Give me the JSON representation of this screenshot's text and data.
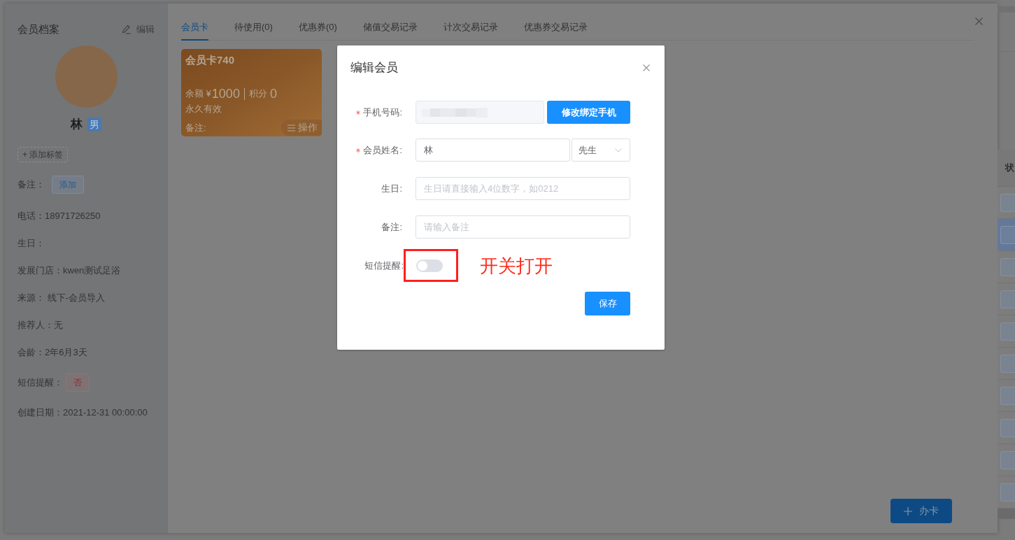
{
  "drawer": {
    "profile": {
      "title": "会员档案",
      "edit_label": "编辑",
      "name": "林",
      "gender": "男",
      "add_tag_label": "+ 添加标签",
      "remark_label": "备注：",
      "remark_button": "添加",
      "fields": [
        {
          "kind": "text",
          "text": "电话：18971726250"
        },
        {
          "kind": "text",
          "text": "生日："
        },
        {
          "kind": "text",
          "text": "发展门店：kwen测试足浴"
        },
        {
          "kind": "text",
          "text": "来源： 线下-会员导入"
        },
        {
          "kind": "text",
          "text": "推荐人：无"
        },
        {
          "kind": "text",
          "text": "会龄：2年6月3天"
        },
        {
          "kind": "tag",
          "label": "短信提醒：",
          "value": "否",
          "on": false
        },
        {
          "kind": "text",
          "text": "创建日期：2021-12-31 00:00:00"
        }
      ]
    },
    "tabs": [
      {
        "label": "会员卡",
        "selected": true
      },
      {
        "label": "待使用(0)",
        "selected": false
      },
      {
        "label": "优惠券(0)",
        "selected": false
      },
      {
        "label": "储值交易记录",
        "selected": false
      },
      {
        "label": "计次交易记录",
        "selected": false
      },
      {
        "label": "优惠券交易记录",
        "selected": false
      }
    ],
    "cards": [
      {
        "title": "会员卡740",
        "balance_label": "余额 ¥",
        "balance": "1000",
        "points_label": "积分",
        "points": "0",
        "validity": "永久有效",
        "remark_label": "备注:",
        "action_label": "操作"
      }
    ],
    "issue_card_button": "办卡"
  },
  "background_table": {
    "header": "状",
    "rows": [
      {
        "selected": false
      },
      {
        "selected": true
      },
      {
        "selected": false
      },
      {
        "selected": false
      },
      {
        "selected": false
      },
      {
        "selected": false
      },
      {
        "selected": false
      },
      {
        "selected": false
      },
      {
        "selected": false
      },
      {
        "selected": false
      }
    ]
  },
  "dialog": {
    "title": "编辑会员",
    "fields": [
      {
        "kind": "phone",
        "label": "手机号码:",
        "required": true,
        "disabled": true,
        "button": "修改绑定手机"
      },
      {
        "kind": "name",
        "label": "会员姓名:",
        "required": true,
        "value": "林",
        "title_select": "先生"
      },
      {
        "kind": "input",
        "label": "生日:",
        "required": false,
        "placeholder": "生日请直接输入4位数字，如0212"
      },
      {
        "kind": "input",
        "label": "备注:",
        "required": false,
        "placeholder": "请输入备注"
      },
      {
        "kind": "switch",
        "label": "短信提醒:",
        "on": false,
        "highlighted": true,
        "annotation": "开关打开"
      }
    ],
    "save_button": "保存"
  }
}
